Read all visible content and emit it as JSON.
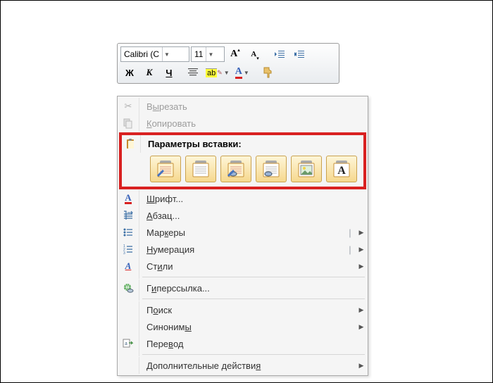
{
  "toolbar": {
    "font_name": "Calibri (С",
    "font_size": "11",
    "bold": "Ж",
    "italic": "К",
    "underline": "Ч",
    "highlight_glyph": "ab",
    "fontcolor_glyph": "A",
    "grow_font_glyph": "A",
    "shrink_font_glyph": "A"
  },
  "menu": {
    "cut": [
      "В",
      "ы",
      "резать"
    ],
    "copy": [
      "К",
      "опировать"
    ],
    "paste_header": "Параметры вставки:",
    "font": [
      "Ш",
      "рифт..."
    ],
    "paragraph": [
      "А",
      "бзац..."
    ],
    "bullets": [
      "Мар",
      "к",
      "еры"
    ],
    "numbering": [
      "Н",
      "умерация"
    ],
    "styles": [
      "Ст",
      "и",
      "ли"
    ],
    "hyperlink": [
      "Г",
      "и",
      "перссылка..."
    ],
    "find": [
      "П",
      "о",
      "иск"
    ],
    "synonyms": [
      "Синоним",
      "ы"
    ],
    "translate": [
      "Пере",
      "в",
      "од"
    ],
    "more_actions": [
      "Дополнительные действи",
      "я"
    ]
  },
  "paste_options": [
    "keep-source-formatting",
    "merge-formatting",
    "use-destination-styles",
    "link-data",
    "picture",
    "keep-text-only"
  ],
  "glyph_A": "A"
}
